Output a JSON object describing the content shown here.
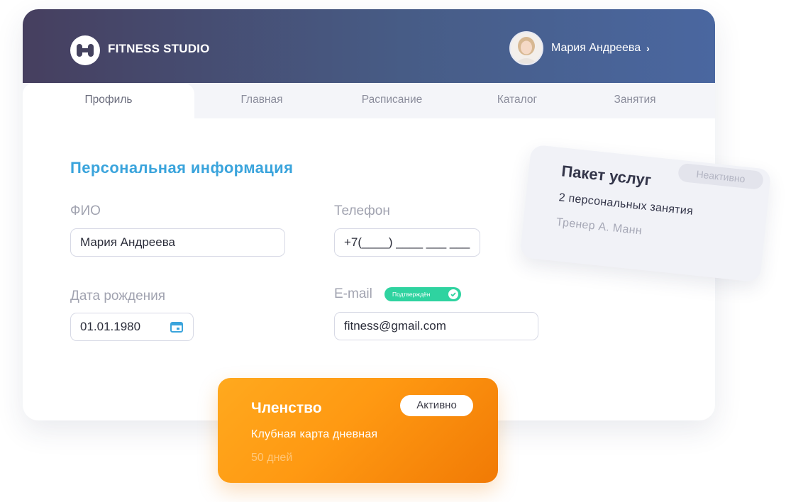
{
  "header": {
    "brand": "FITNESS STUDIO",
    "user_name": "Мария Андреева",
    "user_chevron": "›"
  },
  "tabs": [
    {
      "label": "Профиль",
      "active": true
    },
    {
      "label": "Главная",
      "active": false
    },
    {
      "label": "Расписание",
      "active": false
    },
    {
      "label": "Каталог",
      "active": false
    },
    {
      "label": "Занятия",
      "active": false
    }
  ],
  "profile": {
    "section_title": "Персональная информация",
    "fio_label": "ФИО",
    "fio_value": "Мария Андреева",
    "phone_label": "Телефон",
    "phone_value": "+7(____) ____ ___ ___",
    "birth_label": "Дата рождения",
    "birth_value": "01.01.1980",
    "email_label": "E-mail",
    "email_badge": "Подтверждён",
    "email_value": "fitness@gmail.com"
  },
  "package_card": {
    "title": "Пакет услуг",
    "status": "Неактивно",
    "subtitle": "2 персональных занятия",
    "trainer": "Тренер А. Манн"
  },
  "membership_card": {
    "title": "Членство",
    "status": "Активно",
    "subtitle": "Клубная карта дневная",
    "days": "50 дней"
  },
  "colors": {
    "accent_blue": "#3aa4dc",
    "header_start": "#463f5f",
    "header_end": "#4a67a0",
    "badge_green": "#2fd3a0",
    "membership_orange": "#ff9912"
  },
  "icons": {
    "logo": "dumbbell-logo-icon",
    "calendar": "calendar-icon",
    "verified": "check-circle-icon",
    "chevron": "chevron-right-icon"
  }
}
